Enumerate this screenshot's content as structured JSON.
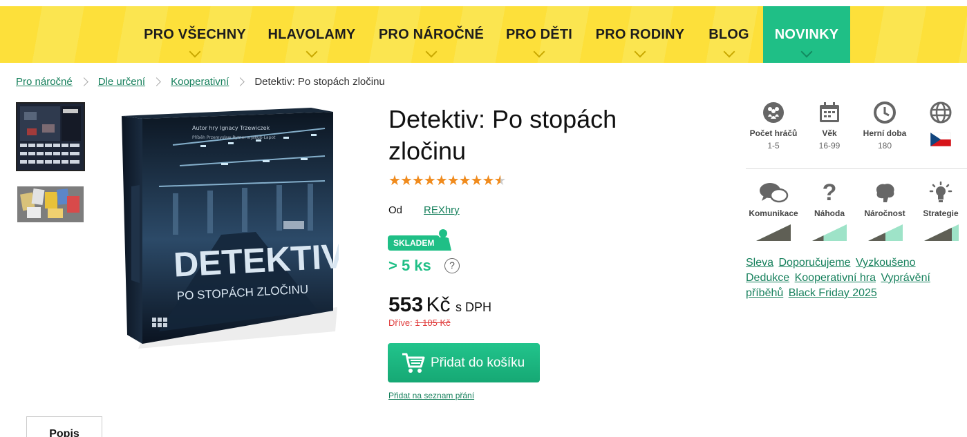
{
  "nav": {
    "items": [
      {
        "label": "PRO VŠECHNY"
      },
      {
        "label": "HLAVOLAMY"
      },
      {
        "label": "PRO NÁROČNÉ"
      },
      {
        "label": "PRO DĚTI"
      },
      {
        "label": "PRO RODINY"
      },
      {
        "label": "BLOG"
      },
      {
        "label": "NOVINKY"
      }
    ],
    "active_color": "#1fbf86",
    "bg_color": "#fde03a"
  },
  "breadcrumb": {
    "items": [
      "Pro náročné",
      "Dle určení",
      "Kooperativní"
    ],
    "current": "Detektiv: Po stopách zločinu"
  },
  "product": {
    "title": "Detektiv: Po stopách zločinu",
    "rating_stars": 9.5,
    "rating_max": 10,
    "by_label": "Od",
    "publisher": "REXhry",
    "stock_badge": "SKLADEM",
    "stock_count": "> 5 ks",
    "help_glyph": "?",
    "price_value": "553",
    "price_currency": "Kč",
    "price_vat": "s DPH",
    "old_price_label": "Dříve:",
    "old_price": "1 105 Kč",
    "cart_button": "Přidat do košíku",
    "wishlist_link": "Přidat na seznam přání",
    "box_title": "DETEKTIV",
    "box_subtitle": "PO STOPÁCH ZLOČINU",
    "box_author_line": "Autor hry Ignacy Trzewiczek",
    "box_story_line": "Příběh Przemysław Rymer a Jakub Łapot"
  },
  "attributes": {
    "top": [
      {
        "label": "Počet hráčů",
        "value": "1-5",
        "icon": "players-icon"
      },
      {
        "label": "Věk",
        "value": "16-99",
        "icon": "calendar-icon"
      },
      {
        "label": "Herní doba",
        "value": "180",
        "icon": "clock-icon"
      },
      {
        "label": "",
        "value": "",
        "icon": "globe-icon",
        "flag": "czech-flag"
      }
    ],
    "meters": [
      {
        "label": "Komunikace",
        "level": 1.0,
        "icon": "speech-bubbles-icon"
      },
      {
        "label": "Náhoda",
        "level": 0.33,
        "icon": "question-mark-icon"
      },
      {
        "label": "Náročnost",
        "level": 0.5,
        "icon": "brain-icon"
      },
      {
        "label": "Strategie",
        "level": 0.8,
        "icon": "lightbulb-icon"
      }
    ],
    "meter_dark": "#5f5f55",
    "meter_light": "#9ee3c8"
  },
  "tags": [
    "Sleva",
    "Doporučujeme",
    "Vyzkoušeno",
    "Dedukce",
    "Kooperativní hra",
    "Vyprávění příběhů",
    "Black Friday 2025"
  ],
  "tabs": [
    {
      "label": "Popis"
    }
  ]
}
